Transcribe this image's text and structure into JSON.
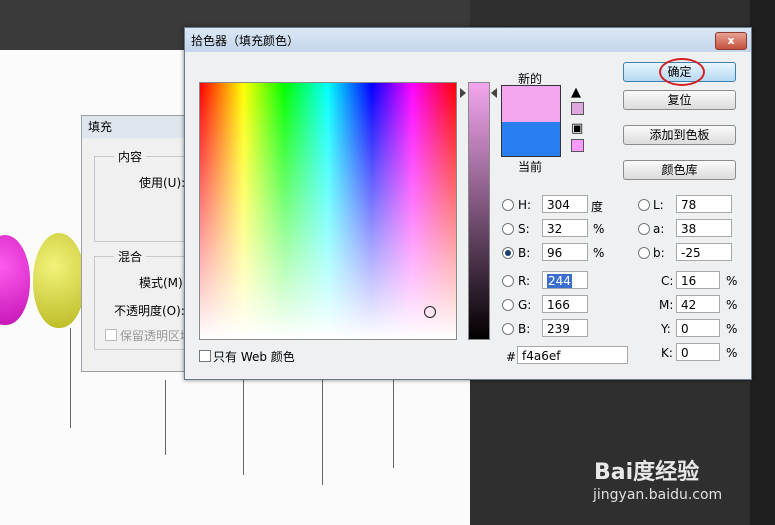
{
  "picker": {
    "title": "拾色器（填充颜色）",
    "close_glyph": "x",
    "label_new": "新的",
    "label_current": "当前",
    "web_only_label": "只有 Web 颜色",
    "buttons": {
      "ok": "确定",
      "reset": "复位",
      "add_swatch": "添加到色板",
      "libraries": "颜色库"
    },
    "hsb": {
      "h": {
        "label": "H:",
        "value": "304",
        "unit": "度"
      },
      "s": {
        "label": "S:",
        "value": "32",
        "unit": "%"
      },
      "b": {
        "label": "B:",
        "value": "96",
        "unit": "%"
      }
    },
    "rgb": {
      "r": {
        "label": "R:",
        "value": "244"
      },
      "g": {
        "label": "G:",
        "value": "166"
      },
      "b": {
        "label": "B:",
        "value": "239"
      }
    },
    "lab": {
      "l": {
        "label": "L:",
        "value": "78"
      },
      "a": {
        "label": "a:",
        "value": "38"
      },
      "b": {
        "label": "b:",
        "value": "-25"
      }
    },
    "cmyk": {
      "c": {
        "label": "C:",
        "value": "16",
        "unit": "%"
      },
      "m": {
        "label": "M:",
        "value": "42",
        "unit": "%"
      },
      "y": {
        "label": "Y:",
        "value": "0",
        "unit": "%"
      },
      "k": {
        "label": "K:",
        "value": "0",
        "unit": "%"
      }
    },
    "hex": {
      "label": "#",
      "value": "f4a6ef"
    },
    "colors": {
      "new": "#f4a6ef",
      "current": "#2a7ff0",
      "selected_mode": "B"
    }
  },
  "fill_dialog": {
    "title": "填充",
    "content_group": "内容",
    "use_label": "使用(U):",
    "blend_group": "混合",
    "mode_label": "模式(M):",
    "opacity_label": "不透明度(O):",
    "preserve_label": "保留透明区域"
  },
  "watermark": {
    "logo": "Bai度经验",
    "url": "jingyan.baidu.com"
  }
}
